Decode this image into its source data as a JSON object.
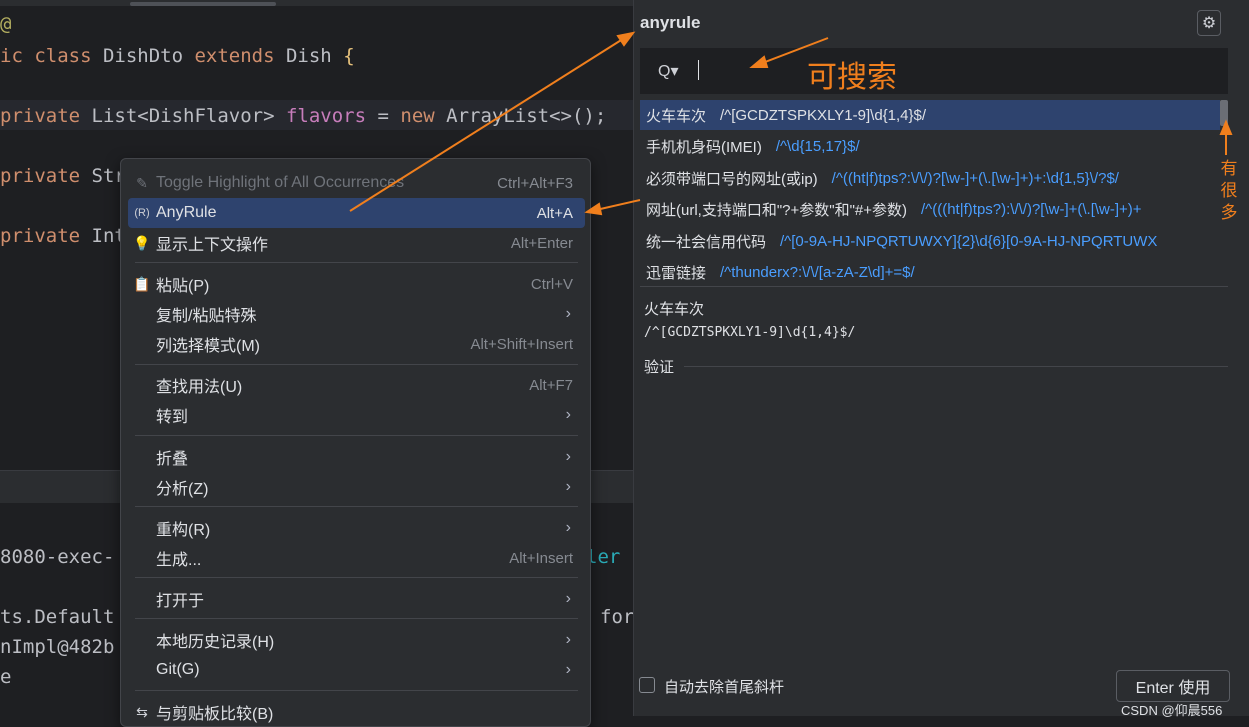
{
  "editor": {
    "lines": {
      "l0": "@",
      "l1a": "ic class ",
      "l1b": "DishDto ",
      "l1c": "extends ",
      "l1d": "Dish ",
      "l1e": "{",
      "l2a": "private ",
      "l2b": "List<DishFlavor> ",
      "l2c": "flavors",
      "l2d": " = ",
      "l2e": "new ",
      "l2f": "ArrayList<>();",
      "l3a": "private ",
      "l3b": "Str",
      "l4a": "private ",
      "l4b": "Int"
    }
  },
  "console": {
    "c1": "8080-exec-",
    "c1b": "ler",
    "c2": "ts.Default",
    "c2b": "for",
    "c2c": "t",
    "c3": "nImpl@482b",
    "c4": "e"
  },
  "menu": {
    "items": [
      {
        "label": "Toggle Highlight of All Occurrences",
        "shortcut": "Ctrl+Alt+F3",
        "icon": "✎"
      },
      {
        "label": "AnyRule",
        "shortcut": "Alt+A",
        "icon": "(R)"
      },
      {
        "label": "显示上下文操作",
        "shortcut": "Alt+Enter",
        "icon": "💡"
      },
      {
        "label": "粘贴(P)",
        "shortcut": "Ctrl+V",
        "icon": "📋"
      },
      {
        "label": "复制/粘贴特殊",
        "shortcut": "",
        "icon": ""
      },
      {
        "label": "列选择模式(M)",
        "shortcut": "Alt+Shift+Insert",
        "icon": ""
      },
      {
        "label": "查找用法(U)",
        "shortcut": "Alt+F7",
        "icon": ""
      },
      {
        "label": "转到",
        "shortcut": "",
        "icon": ""
      },
      {
        "label": "折叠",
        "shortcut": "",
        "icon": ""
      },
      {
        "label": "分析(Z)",
        "shortcut": "",
        "icon": ""
      },
      {
        "label": "重构(R)",
        "shortcut": "",
        "icon": ""
      },
      {
        "label": "生成...",
        "shortcut": "Alt+Insert",
        "icon": ""
      },
      {
        "label": "打开于",
        "shortcut": "",
        "icon": ""
      },
      {
        "label": "本地历史记录(H)",
        "shortcut": "",
        "icon": ""
      },
      {
        "label": "Git(G)",
        "shortcut": "",
        "icon": ""
      },
      {
        "label": "与剪贴板比较(B)",
        "shortcut": "",
        "icon": "⇆"
      }
    ],
    "arrow": "›"
  },
  "anyrule": {
    "title": "anyrule",
    "search_placeholder": "",
    "search_icon": "Q▾",
    "gear_icon": "⚙",
    "rules": [
      {
        "name": "火车车次",
        "regex": "/^[GCDZTSPKXLY1-9]\\d{1,4}$/"
      },
      {
        "name": "手机机身码(IMEI)",
        "regex": "/^\\d{15,17}$/"
      },
      {
        "name": "必须带端口号的网址(或ip)",
        "regex": "/^((ht|f)tps?:\\/\\/)?[\\w-]+(\\.[\\w-]+)+:\\d{1,5}\\/?$/"
      },
      {
        "name": "网址(url,支持端口和\"?+参数\"和\"#+参数)",
        "regex": "/^(((ht|f)tps?):\\/\\/)?[\\w-]+(\\.[\\w-]+)+"
      },
      {
        "name": "统一社会信用代码",
        "regex": "/^[0-9A-HJ-NPQRTUWXY]{2}\\d{6}[0-9A-HJ-NPQRTUWX"
      },
      {
        "name": "迅雷链接",
        "regex": "/^thunderx?:\\/\\/[a-zA-Z\\d]+=$/"
      }
    ],
    "detail_name": "火车车次",
    "detail_regex": "/^[GCDZTSPKXLY1-9]\\d{1,4}$/",
    "verify_label": "验证",
    "checkbox_label": "自动去除首尾斜杆",
    "enter_button": "Enter 使用"
  },
  "annotations": {
    "searchable": "可搜索",
    "many": "有很多"
  },
  "watermark": "CSDN @仰晨556",
  "colors": {
    "accent": "#f07f1d",
    "selection": "#2e436e",
    "regex": "#4a9eff"
  }
}
